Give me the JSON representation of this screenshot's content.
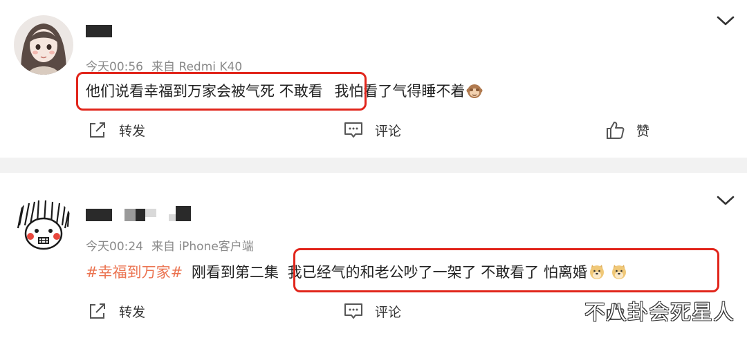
{
  "posts": [
    {
      "time": "今天00:56",
      "source": "来自 Redmi K40",
      "content_boxed": "他们说看幸福到万家会被气死 不敢看",
      "content_rest": "我怕看了气得睡不着",
      "emoji": "monkey-face",
      "actions": {
        "repost": "转发",
        "comment": "评论",
        "like": "赞"
      }
    },
    {
      "time": "今天00:24",
      "source": "来自 iPhone客户端",
      "hashtag": "#幸福到万家#",
      "content_pre": "刚看到第二集",
      "content_boxed": "我已经气的和老公吵了一架了 不敢看了 怕离婚",
      "emoji": "doge-face",
      "actions": {
        "repost": "转发",
        "comment": "评论"
      }
    }
  ],
  "colors": {
    "hashtag": "#eb7350",
    "highlight_box": "#e1251b",
    "divider": "#f2f2f2"
  },
  "watermark": "不八卦会死星人"
}
